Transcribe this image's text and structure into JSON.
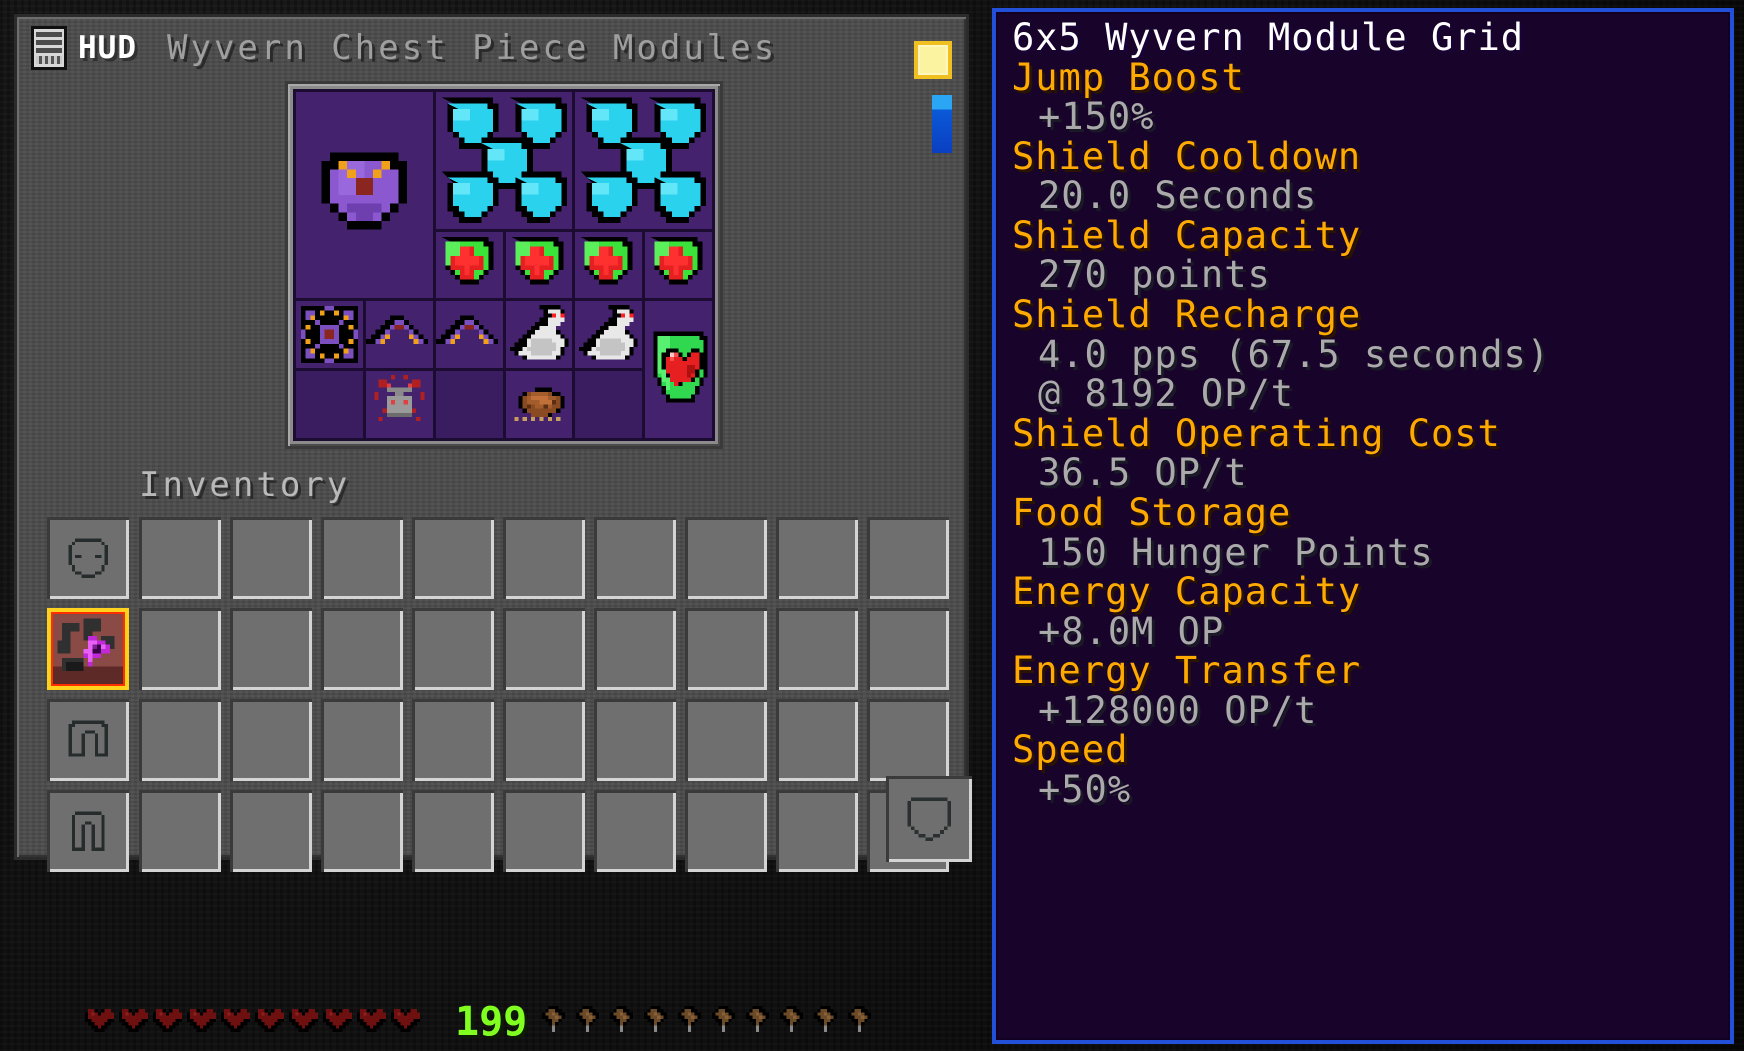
{
  "window": {
    "hud_badge": "HUD",
    "title": "Wyvern Chest Piece Modules",
    "inventory_label": "Inventory"
  },
  "toolbar": {
    "buttons": [
      {
        "name": "theme-toggle-button",
        "color": "#fbf3a0"
      },
      {
        "name": "info-toggle-button",
        "color": "#2aa6f5"
      }
    ]
  },
  "module_grid": {
    "columns": 6,
    "rows": 5,
    "modules": [
      {
        "slot": "r1c1",
        "name": "Wyvern Shield Module",
        "icon": "shield-purple-icon",
        "span": "2x3"
      },
      {
        "slot": "r1c3",
        "name": "Energy Storage Module",
        "icon": "shield-cyan-icon",
        "span": "2x2"
      },
      {
        "slot": "r1c5",
        "name": "Energy Storage Module",
        "icon": "shield-cyan-icon",
        "span": "2x2"
      },
      {
        "slot": "r3c3",
        "name": "Shield Recovery Module",
        "icon": "shield-green-cross-icon",
        "span": "1x1"
      },
      {
        "slot": "r3c4",
        "name": "Shield Recovery Module",
        "icon": "shield-green-cross-icon",
        "span": "1x1"
      },
      {
        "slot": "r3c5",
        "name": "Shield Recovery Module",
        "icon": "shield-green-cross-icon",
        "span": "1x1"
      },
      {
        "slot": "r3c6",
        "name": "Shield Recovery Module",
        "icon": "shield-green-cross-icon",
        "span": "1x1"
      },
      {
        "slot": "r3c7",
        "name": "Draconic Core Module",
        "icon": "core-starburst-icon",
        "span": "1x1"
      },
      {
        "slot": "r4c3",
        "name": "Jump Boost Module",
        "icon": "chevron-jump-icon",
        "span": "1x1"
      },
      {
        "slot": "r4c4",
        "name": "Jump Boost Module",
        "icon": "chevron-jump-icon",
        "span": "1x1"
      },
      {
        "slot": "r4c5",
        "name": "Speed Module",
        "icon": "rabbit-icon",
        "span": "1x1"
      },
      {
        "slot": "r4c6",
        "name": "Speed Module",
        "icon": "rabbit-icon",
        "span": "1x1"
      },
      {
        "slot": "r4c7",
        "name": "Auto Feed Module",
        "icon": "shield-heart-icon",
        "span": "1x2"
      },
      {
        "slot": "r5c2",
        "name": "Flight Module",
        "icon": "anvil-redstone-icon",
        "span": "1x1"
      },
      {
        "slot": "r5c4",
        "name": "Food Storage Module",
        "icon": "cooked-steak-icon",
        "span": "1x1"
      }
    ]
  },
  "armor_slots": [
    {
      "name": "helmet-slot",
      "icon": "helmet-icon",
      "selected": false
    },
    {
      "name": "chestplate-slot",
      "icon": "wyvern-chestplate-icon",
      "selected": true
    },
    {
      "name": "leggings-slot",
      "icon": "leggings-icon",
      "selected": false
    },
    {
      "name": "boots-slot",
      "icon": "boots-icon",
      "selected": false
    }
  ],
  "offhand_slot": {
    "name": "offhand-slot",
    "icon": "shield-outline-icon"
  },
  "inventory": {
    "rows": 3,
    "columns": 9,
    "hotbar_columns": 9
  },
  "tooltip": {
    "title": "6x5 Wyvern Module Grid",
    "entries": [
      {
        "name": "Jump Boost",
        "values": [
          "+150%"
        ]
      },
      {
        "name": "Shield Cooldown",
        "values": [
          "20.0 Seconds"
        ]
      },
      {
        "name": "Shield Capacity",
        "values": [
          "270 points"
        ]
      },
      {
        "name": "Shield Recharge",
        "values": [
          "4.0 pps (67.5 seconds)",
          "@ 8192 OP/t"
        ]
      },
      {
        "name": "Shield Operating Cost",
        "values": [
          "36.5 OP/t"
        ]
      },
      {
        "name": "Food Storage",
        "values": [
          "150 Hunger Points"
        ]
      },
      {
        "name": "Energy Capacity",
        "values": [
          "+8.0M OP"
        ]
      },
      {
        "name": "Energy Transfer",
        "values": [
          "+128000 OP/t"
        ]
      },
      {
        "name": "Speed",
        "values": [
          "+50%"
        ]
      }
    ]
  },
  "hud": {
    "hearts": 10,
    "food_icons": 10,
    "xp_level": "199"
  },
  "colors": {
    "tooltip_border": "#2250d8",
    "tooltip_background": "#18032a",
    "stat_name": "#ffaa00",
    "stat_value": "#aaaaaa",
    "grid_background": "#1d0c31",
    "cell_background": "#3d1f63",
    "selected_slot_outline": "#ffd21e"
  }
}
